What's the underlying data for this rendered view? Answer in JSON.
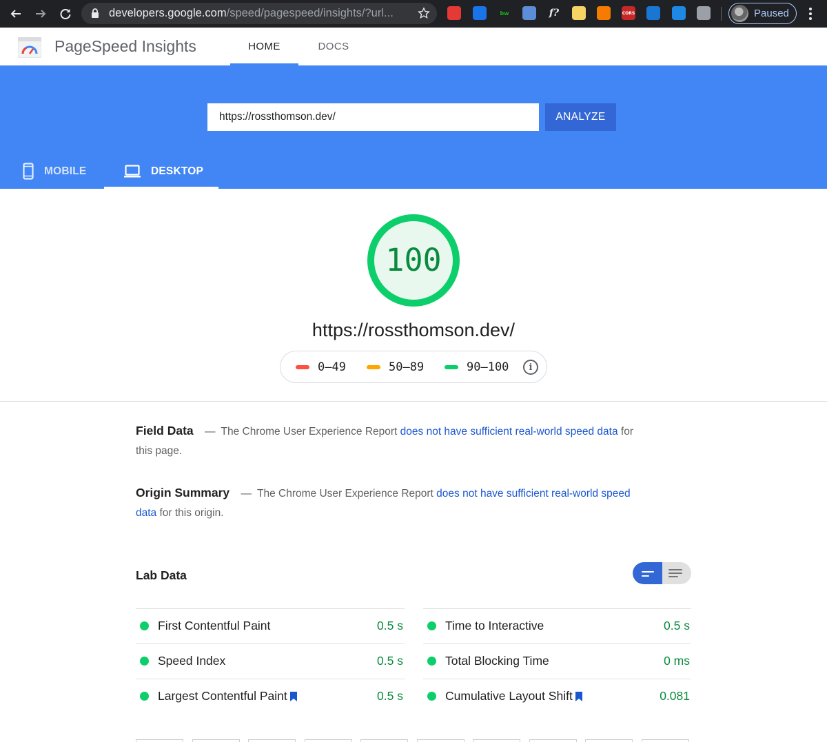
{
  "browser": {
    "url_host": "developers.google.com",
    "url_path": "/speed/pagespeed/insights/?url...",
    "extensions": [
      {
        "icon": "ublock-icon",
        "color": "#e53935",
        "text": ""
      },
      {
        "icon": "ext-blue-check-icon",
        "color": "#1a73e8",
        "text": ""
      },
      {
        "icon": "builtwith-icon",
        "color": "#202124",
        "text": "bw"
      },
      {
        "icon": "ext-square-icon",
        "color": "#5c8dd6",
        "text": ""
      },
      {
        "icon": "font-finder-icon",
        "color": "#202124",
        "text": "f?"
      },
      {
        "icon": "notes-icon",
        "color": "#f6d365",
        "text": ""
      },
      {
        "icon": "graph-icon",
        "color": "#f57c00",
        "text": ""
      },
      {
        "icon": "cors-icon",
        "color": "#c62828",
        "text": "CORS"
      },
      {
        "icon": "wappalyzer-icon",
        "color": "#1976d2",
        "text": ""
      },
      {
        "icon": "1password-icon",
        "color": "#1e88e5",
        "text": ""
      },
      {
        "icon": "puzzle-icon",
        "color": "#9aa0a6",
        "text": ""
      }
    ],
    "profile_label": "Paused"
  },
  "app": {
    "title": "PageSpeed Insights",
    "nav": {
      "home": "HOME",
      "docs": "DOCS"
    }
  },
  "analyze": {
    "url_value": "https://rossthomson.dev/",
    "button_label": "ANALYZE"
  },
  "device_tabs": {
    "mobile": "MOBILE",
    "desktop": "DESKTOP",
    "selected": "desktop"
  },
  "score": {
    "value": "100",
    "percent": 100,
    "tested_url": "https://rossthomson.dev/",
    "legend": [
      {
        "range": "0–49",
        "color": "#ff4e42"
      },
      {
        "range": "50–89",
        "color": "#ffa400"
      },
      {
        "range": "90–100",
        "color": "#0cce6b"
      }
    ]
  },
  "field_data": {
    "title": "Field Data",
    "dash": "—",
    "prefix": "The Chrome User Experience Report",
    "link": "does not have sufficient real-world speed data",
    "suffix": "for this page."
  },
  "origin_summary": {
    "title": "Origin Summary",
    "dash": "—",
    "prefix": "The Chrome User Experience Report",
    "link": "does not have sufficient real-world speed data",
    "suffix": "for this origin."
  },
  "lab_data": {
    "title": "Lab Data",
    "metrics": [
      {
        "name": "First Contentful Paint",
        "value": "0.5 s",
        "bookmark": false
      },
      {
        "name": "Time to Interactive",
        "value": "0.5 s",
        "bookmark": false
      },
      {
        "name": "Speed Index",
        "value": "0.5 s",
        "bookmark": false
      },
      {
        "name": "Total Blocking Time",
        "value": "0 ms",
        "bookmark": false
      },
      {
        "name": "Largest Contentful Paint",
        "value": "0.5 s",
        "bookmark": true
      },
      {
        "name": "Cumulative Layout Shift",
        "value": "0.081",
        "bookmark": true
      }
    ]
  },
  "colors": {
    "accent": "#4285f4",
    "button": "#3367d6",
    "pass": "#0cce6b",
    "pass_text": "#0a8a3e",
    "link": "#1a57cf"
  }
}
